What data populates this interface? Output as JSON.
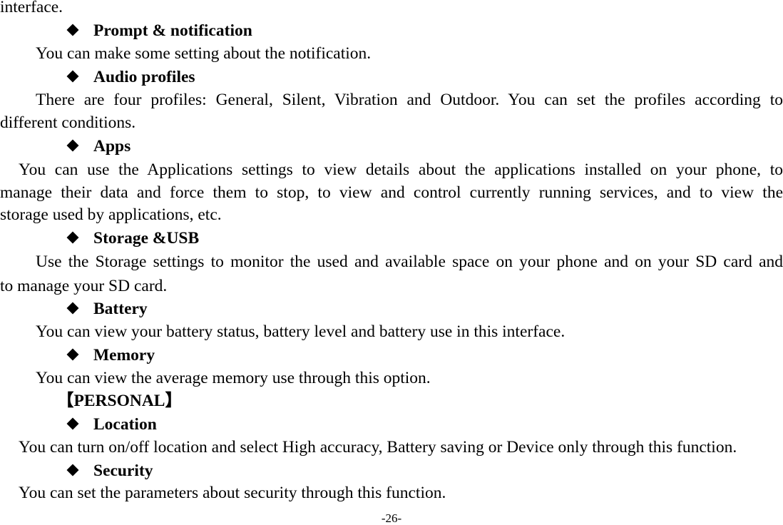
{
  "document": {
    "intro_tail": "interface.",
    "sections": [
      {
        "heading": "Prompt & notification",
        "lines": [
          "You can make some setting about the notification."
        ]
      },
      {
        "heading": "Audio profiles",
        "lines": [
          "There are four profiles: General, Silent, Vibration and Outdoor. You can set the profiles according to",
          "different conditions."
        ]
      },
      {
        "heading": "Apps",
        "lines": [
          "You can use the Applications settings to view details about the applications installed on your phone, to",
          "manage their data and force them to stop, to view and control currently running services, and to view the",
          "storage used by applications, etc."
        ]
      },
      {
        "heading": "Storage &USB",
        "lines": [
          "Use the Storage settings to monitor the used and available space on your phone and on your SD card and",
          "to manage your SD card."
        ]
      },
      {
        "heading": "Battery",
        "lines": [
          "You can view your battery status, battery level and battery use in this interface."
        ]
      },
      {
        "heading": "Memory",
        "lines": [
          "You can view the average memory use through this option."
        ]
      }
    ],
    "group_label": "【PERSONAL】",
    "personal_sections": [
      {
        "heading": "Location",
        "lines": [
          "You can turn on/off location and select High accuracy, Battery saving or Device only through this function."
        ]
      },
      {
        "heading": "Security",
        "lines": [
          "You can set the parameters about security through this function."
        ]
      }
    ],
    "page_number": "-26-"
  }
}
